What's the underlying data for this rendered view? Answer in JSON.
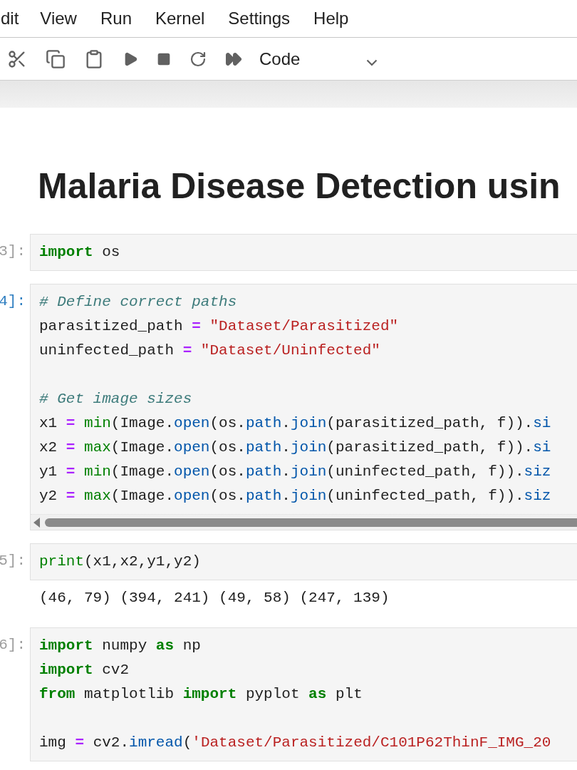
{
  "menu": [
    "dit",
    "View",
    "Run",
    "Kernel",
    "Settings",
    "Help"
  ],
  "cell_type_select": {
    "value": "Code"
  },
  "title": "Malaria Disease Detection usin",
  "cells": [
    {
      "prompt": "3]:",
      "selected": false,
      "scrollable": false,
      "blocks": [
        [
          [
            {
              "kind": "kw",
              "text": "import"
            },
            {
              "kind": "plain",
              "text": " os"
            }
          ]
        ]
      ]
    },
    {
      "prompt": "4]:",
      "selected": true,
      "scrollable": true,
      "blocks": [
        [
          [
            {
              "kind": "comment",
              "text": "# Define correct paths"
            }
          ],
          [
            {
              "kind": "plain",
              "text": "parasitized_path "
            },
            {
              "kind": "op",
              "text": "= "
            },
            {
              "kind": "str",
              "text": "\"Dataset/Parasitized\""
            }
          ],
          [
            {
              "kind": "plain",
              "text": "uninfected_path "
            },
            {
              "kind": "op",
              "text": "= "
            },
            {
              "kind": "str",
              "text": "\"Dataset/Uninfected\""
            }
          ]
        ],
        [
          [
            {
              "kind": "comment",
              "text": "# Get image sizes"
            }
          ],
          [
            {
              "kind": "plain",
              "text": "x1 "
            },
            {
              "kind": "op",
              "text": "= "
            },
            {
              "kind": "builtin",
              "text": "min"
            },
            {
              "kind": "plain",
              "text": "(Image."
            },
            {
              "kind": "attr",
              "text": "open"
            },
            {
              "kind": "plain",
              "text": "(os."
            },
            {
              "kind": "attr",
              "text": "path"
            },
            {
              "kind": "plain",
              "text": "."
            },
            {
              "kind": "attr",
              "text": "join"
            },
            {
              "kind": "plain",
              "text": "(parasitized_path, f))."
            },
            {
              "kind": "attr",
              "text": "si"
            }
          ],
          [
            {
              "kind": "plain",
              "text": "x2 "
            },
            {
              "kind": "op",
              "text": "= "
            },
            {
              "kind": "builtin",
              "text": "max"
            },
            {
              "kind": "plain",
              "text": "(Image."
            },
            {
              "kind": "attr",
              "text": "open"
            },
            {
              "kind": "plain",
              "text": "(os."
            },
            {
              "kind": "attr",
              "text": "path"
            },
            {
              "kind": "plain",
              "text": "."
            },
            {
              "kind": "attr",
              "text": "join"
            },
            {
              "kind": "plain",
              "text": "(parasitized_path, f))."
            },
            {
              "kind": "attr",
              "text": "si"
            }
          ],
          [
            {
              "kind": "plain",
              "text": "y1 "
            },
            {
              "kind": "op",
              "text": "= "
            },
            {
              "kind": "builtin",
              "text": "min"
            },
            {
              "kind": "plain",
              "text": "(Image."
            },
            {
              "kind": "attr",
              "text": "open"
            },
            {
              "kind": "plain",
              "text": "(os."
            },
            {
              "kind": "attr",
              "text": "path"
            },
            {
              "kind": "plain",
              "text": "."
            },
            {
              "kind": "attr",
              "text": "join"
            },
            {
              "kind": "plain",
              "text": "(uninfected_path, f))."
            },
            {
              "kind": "attr",
              "text": "siz"
            }
          ],
          [
            {
              "kind": "plain",
              "text": "y2 "
            },
            {
              "kind": "op",
              "text": "= "
            },
            {
              "kind": "builtin",
              "text": "max"
            },
            {
              "kind": "plain",
              "text": "(Image."
            },
            {
              "kind": "attr",
              "text": "open"
            },
            {
              "kind": "plain",
              "text": "(os."
            },
            {
              "kind": "attr",
              "text": "path"
            },
            {
              "kind": "plain",
              "text": "."
            },
            {
              "kind": "attr",
              "text": "join"
            },
            {
              "kind": "plain",
              "text": "(uninfected_path, f))."
            },
            {
              "kind": "attr",
              "text": "siz"
            }
          ]
        ]
      ]
    },
    {
      "prompt": "5]:",
      "selected": false,
      "scrollable": false,
      "blocks": [
        [
          [
            {
              "kind": "builtin",
              "text": "print"
            },
            {
              "kind": "plain",
              "text": "(x1,x2,y1,y2)"
            }
          ]
        ]
      ],
      "output": "(46, 79) (394, 241) (49, 58) (247, 139)"
    },
    {
      "prompt": "6]:",
      "selected": false,
      "scrollable": false,
      "blocks": [
        [
          [
            {
              "kind": "kw",
              "text": "import"
            },
            {
              "kind": "plain",
              "text": " numpy "
            },
            {
              "kind": "kw",
              "text": "as"
            },
            {
              "kind": "plain",
              "text": " np"
            }
          ],
          [
            {
              "kind": "kw",
              "text": "import"
            },
            {
              "kind": "plain",
              "text": " cv2"
            }
          ],
          [
            {
              "kind": "kw",
              "text": "from"
            },
            {
              "kind": "plain",
              "text": " matplotlib "
            },
            {
              "kind": "kw",
              "text": "import"
            },
            {
              "kind": "plain",
              "text": " pyplot "
            },
            {
              "kind": "kw",
              "text": "as"
            },
            {
              "kind": "plain",
              "text": " plt"
            }
          ]
        ],
        [
          [
            {
              "kind": "plain",
              "text": "img "
            },
            {
              "kind": "op",
              "text": "= "
            },
            {
              "kind": "plain",
              "text": "cv2."
            },
            {
              "kind": "attr",
              "text": "imread"
            },
            {
              "kind": "plain",
              "text": "("
            },
            {
              "kind": "str",
              "text": "'Dataset/Parasitized/C101P62ThinF_IMG_20"
            }
          ]
        ]
      ]
    }
  ]
}
